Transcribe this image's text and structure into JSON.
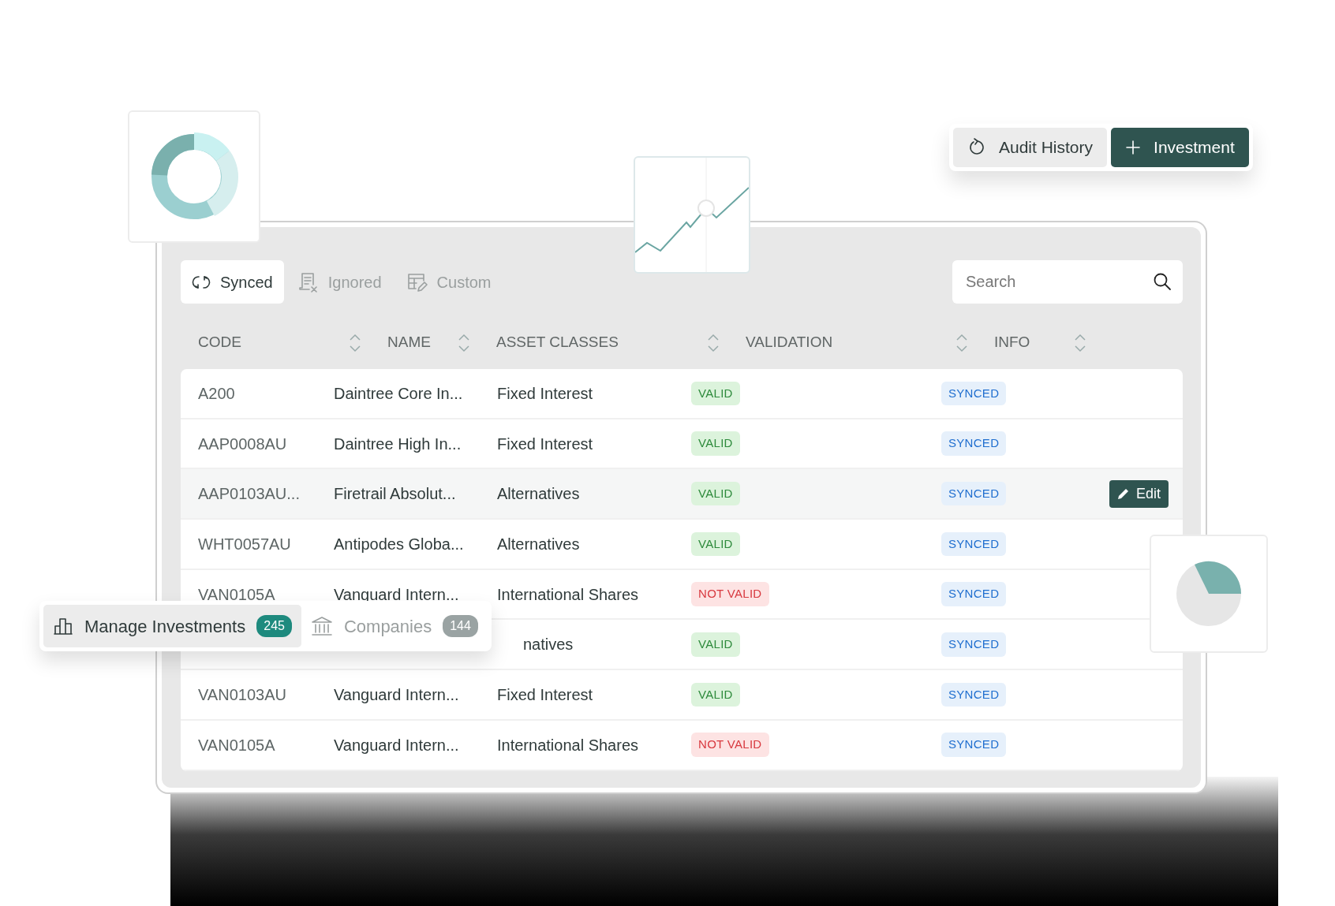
{
  "header_buttons": [
    {
      "kind": "history",
      "label": "Audit History",
      "primary": false
    },
    {
      "kind": "add",
      "label": "Investment",
      "primary": true
    }
  ],
  "tabs": [
    {
      "kind": "sync",
      "label": "Synced",
      "selected": true
    },
    {
      "kind": "ignored",
      "label": "Ignored",
      "selected": false
    },
    {
      "kind": "custom",
      "label": "Custom",
      "selected": false
    }
  ],
  "search": {
    "placeholder": "Search"
  },
  "table": {
    "columns": [
      "CODE",
      "NAME",
      "ASSET CLASSES",
      "VALIDATION",
      "INFO"
    ],
    "rows": [
      {
        "code": "A200",
        "name": "Daintree Core In...",
        "asset_class": "Fixed Interest",
        "validation": {
          "text": "VALID",
          "kind": "valid"
        },
        "info": "SYNCED"
      },
      {
        "code": "AAP0008AU",
        "name": "Daintree High In...",
        "asset_class": "Fixed Interest",
        "validation": {
          "text": "VALID",
          "kind": "valid"
        },
        "info": "SYNCED"
      },
      {
        "code": "AAP0103AU...",
        "name": "Firetrail Absolut...",
        "asset_class": "Alternatives",
        "validation": {
          "text": "VALID",
          "kind": "valid"
        },
        "info": "SYNCED",
        "action": "Edit"
      },
      {
        "code": "WHT0057AU",
        "name": "Antipodes Globa...",
        "asset_class": "Alternatives",
        "validation": {
          "text": "VALID",
          "kind": "valid"
        },
        "info": "SYNCED"
      },
      {
        "code": "VAN0105A",
        "name": "Vanguard Intern...",
        "asset_class": "International Shares",
        "validation": {
          "text": "NOT VALID",
          "kind": "invalid"
        },
        "info": "SYNCED"
      },
      {
        "asset_class": "natives",
        "validation": {
          "text": "VALID",
          "kind": "valid"
        },
        "info": "SYNCED"
      },
      {
        "code": "VAN0103AU",
        "name": "Vanguard Intern...",
        "asset_class": "Fixed Interest",
        "validation": {
          "text": "VALID",
          "kind": "valid"
        },
        "info": "SYNCED"
      },
      {
        "code": "VAN0105A",
        "name": "Vanguard Intern...",
        "asset_class": "International Shares",
        "validation": {
          "text": "NOT VALID",
          "kind": "invalid"
        },
        "info": "SYNCED"
      }
    ]
  },
  "nav": [
    {
      "kind": "chart",
      "label": "Manage Investments",
      "count": "245",
      "selected": true
    },
    {
      "kind": "bank",
      "label": "Companies",
      "count": "144",
      "selected": false
    }
  ]
}
